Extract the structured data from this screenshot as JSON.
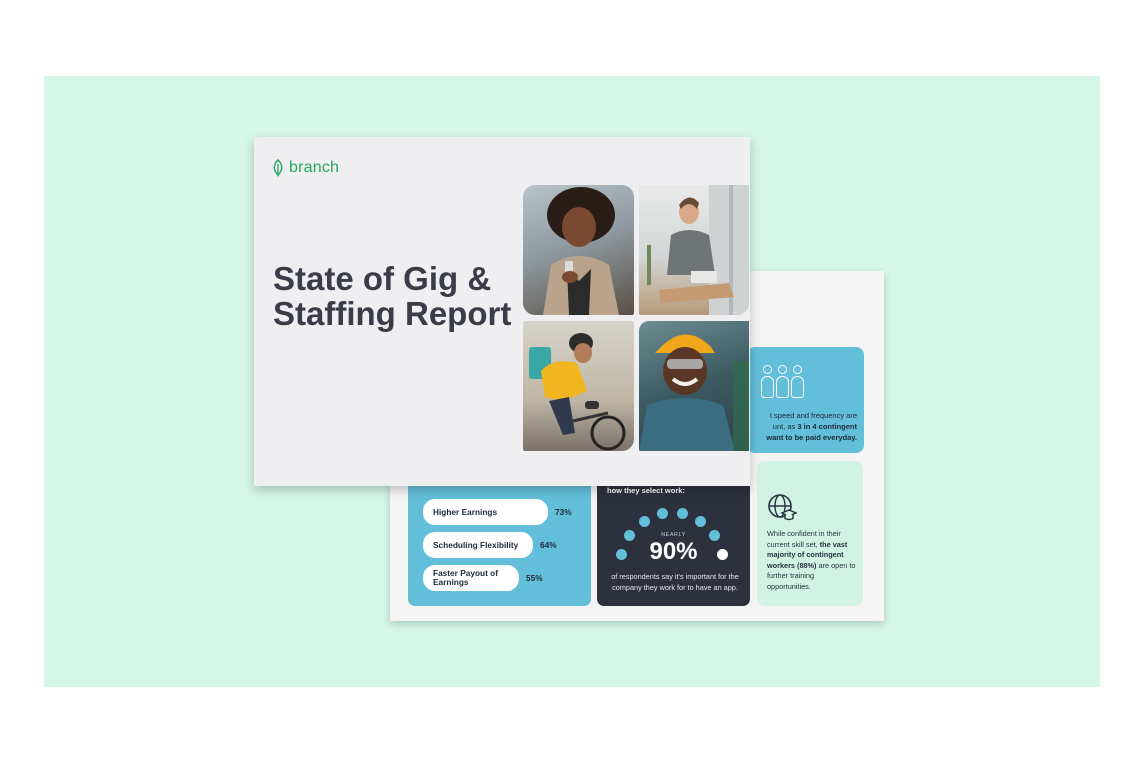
{
  "logo": {
    "text": "branch"
  },
  "cover": {
    "title": "State of Gig & Staffing Report"
  },
  "back": {
    "top_stat": {
      "text_prefix": "t speed and frequency are",
      "text_line2_a": "unt, as ",
      "text_bold": "3 in 4 contingent",
      "text_line3_bold": "want to be paid everyday."
    },
    "bars_title": "how they select work:",
    "bars": [
      {
        "label": "Higher Earnings",
        "value": "73%"
      },
      {
        "label": "Scheduling Flexibility",
        "value": "64%"
      },
      {
        "label": "Faster Payout of Earnings",
        "value": "55%"
      }
    ],
    "app_stat": {
      "nearly": "NEARLY",
      "value": "90%",
      "text": "of respondents say it's important for the company they work for to have an app."
    },
    "training": {
      "text_a": "While confident in their current skill set, ",
      "text_bold": "the vast majority of contingent workers (88%)",
      "text_b": " are open to further training opportunities."
    }
  },
  "colors": {
    "accent_blue": "#62bed9",
    "mint": "#d6f6e7",
    "brand_green": "#26a562",
    "dark": "#2c313d"
  },
  "icons": [
    "leaf-icon",
    "people-icon",
    "globe-graduation-icon"
  ]
}
